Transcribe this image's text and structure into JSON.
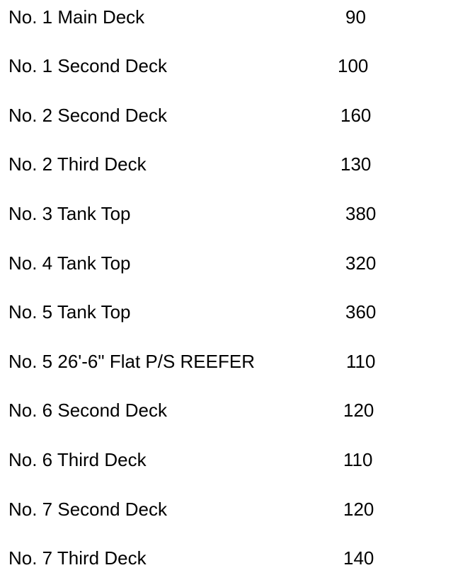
{
  "rows": [
    {
      "label": "No. 1 Main Deck",
      "value": "90"
    },
    {
      "label": "No. 1 Second Deck",
      "value": "100"
    },
    {
      "label": "No. 2 Second Deck",
      "value": "160"
    },
    {
      "label": "No. 2 Third Deck",
      "value": "130"
    },
    {
      "label": "No. 3 Tank Top",
      "value": "380"
    },
    {
      "label": "No. 4 Tank Top",
      "value": "320"
    },
    {
      "label": "No. 5 Tank Top",
      "value": "360"
    },
    {
      "label": "No. 5 26'-6\" Flat P/S REEFER",
      "value": "110"
    },
    {
      "label": "No. 6 Second Deck",
      "value": "120"
    },
    {
      "label": "No. 6 Third Deck",
      "value": "110"
    },
    {
      "label": "No. 7 Second Deck",
      "value": "120"
    },
    {
      "label": "No. 7 Third Deck",
      "value": "140"
    }
  ]
}
